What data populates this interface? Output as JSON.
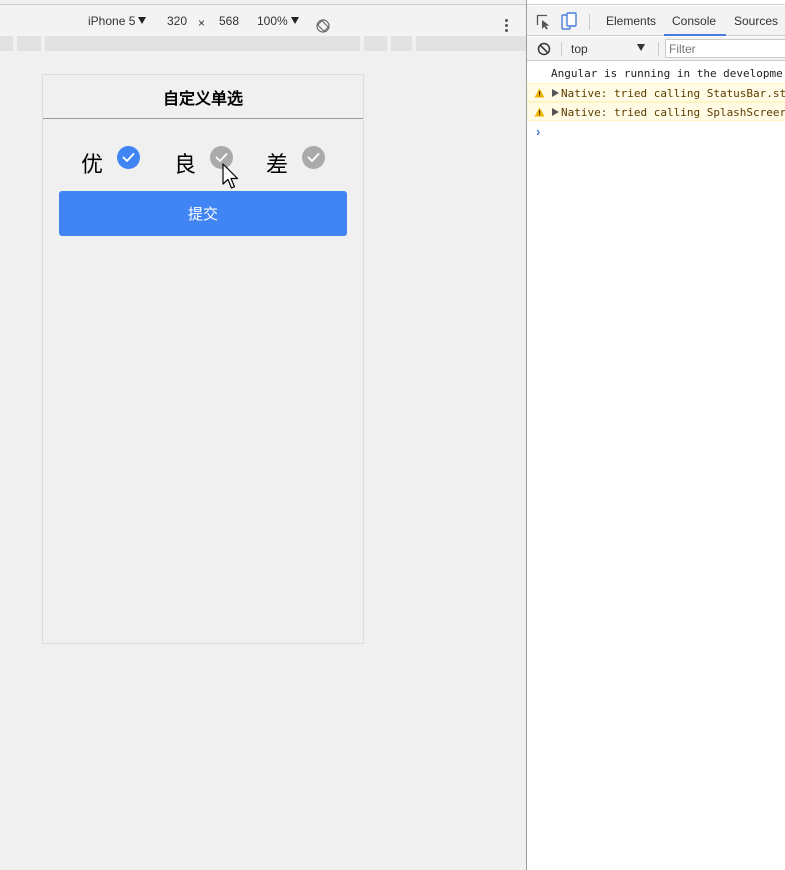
{
  "device_toolbar": {
    "device": "iPhone 5",
    "width": "320",
    "times": "×",
    "height": "568",
    "zoom": "100%",
    "icons": [
      "chevron-down-icon",
      "rotate-icon",
      "kebab-menu-icon"
    ]
  },
  "app": {
    "title": "自定义单选",
    "options": [
      {
        "label": "优",
        "selected": true
      },
      {
        "label": "良",
        "selected": false
      },
      {
        "label": "差",
        "selected": false
      }
    ],
    "submit_label": "提交",
    "colors": {
      "accent": "#4184f3",
      "unselected": "#aaaaaa"
    }
  },
  "devtools": {
    "tabs": [
      {
        "label": "Elements",
        "active": false
      },
      {
        "label": "Console",
        "active": true
      },
      {
        "label": "Sources",
        "active": false
      }
    ],
    "context": "top",
    "filter_placeholder": "Filter",
    "logs": [
      {
        "level": "info",
        "text": "Angular is running in the developme"
      },
      {
        "level": "warning",
        "text": "Native: tried calling StatusBar.st"
      },
      {
        "level": "warning",
        "text": "Native: tried calling SplashScreer"
      }
    ],
    "prompt": "›"
  }
}
